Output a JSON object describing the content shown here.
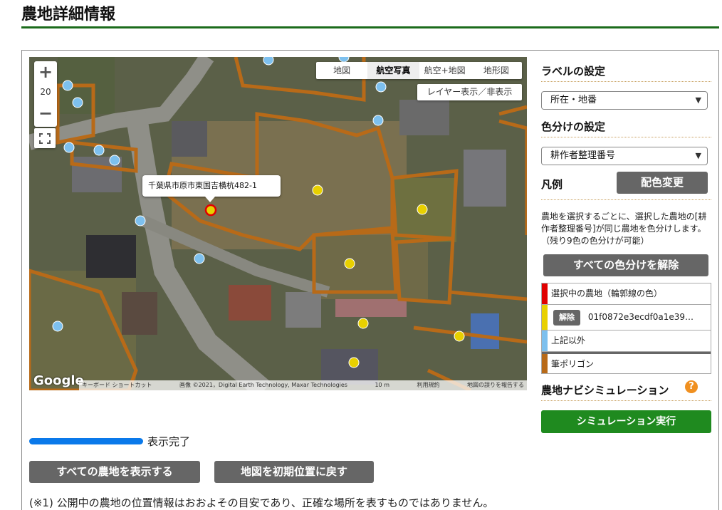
{
  "page": {
    "title": "農地詳細情報"
  },
  "map": {
    "zoom_in": "+",
    "zoom_level": "20",
    "zoom_out": "−",
    "map_types": [
      "地図",
      "航空写真",
      "航空+地図",
      "地形図"
    ],
    "active_map_type": "航空写真",
    "layer_toggle": "レイヤー表示／非表示",
    "popup_address": "千葉県市原市東国吉横杭482-1",
    "google": "Google",
    "attribution_shortcuts": "キーボード ショートカット",
    "attribution_imagery": "画像 ©2021，Digital Earth Technology, Maxar Technologies",
    "attribution_scale": "10 m",
    "attribution_terms": "利用規約",
    "attribution_report": "地図の誤りを報告する"
  },
  "status": {
    "label": "表示完了",
    "progress": 1.0,
    "color": "#0a79ea"
  },
  "buttons": {
    "show_all": "すべての農地を表示する",
    "reset_map": "地図を初期位置に戻す"
  },
  "note": "(※1) 公開中の農地の位置情報はおおよその目安であり、正確な場所を表すものではありません。",
  "panel": {
    "label_heading": "ラベルの設定",
    "label_select": "所在・地番",
    "color_heading": "色分けの設定",
    "color_select": "耕作者整理番号",
    "legend_heading": "凡例",
    "recolor_button": "配色変更",
    "description": "農地を選択するごとに、選択した農地の[耕作者整理番号]が同じ農地を色分けします。（残り9色の色分けが可能）",
    "clear_all_button": "すべての色分けを解除",
    "legend": {
      "selected": "選択中の農地（輪郭線の色）",
      "clear": "解除",
      "owner_id": "01f0872e3ecdf0a1e39…",
      "others": "上記以外",
      "polygon": "筆ポリゴン"
    },
    "nav_heading": "農地ナビシミュレーション",
    "help": "?",
    "simulate_button": "シミュレーション実行"
  },
  "colors": {
    "selected": "#e00000",
    "owner_group": "#e8d000",
    "others": "#7dc0ee",
    "polygon": "#b86a18",
    "simulate": "#1f8a1f"
  }
}
